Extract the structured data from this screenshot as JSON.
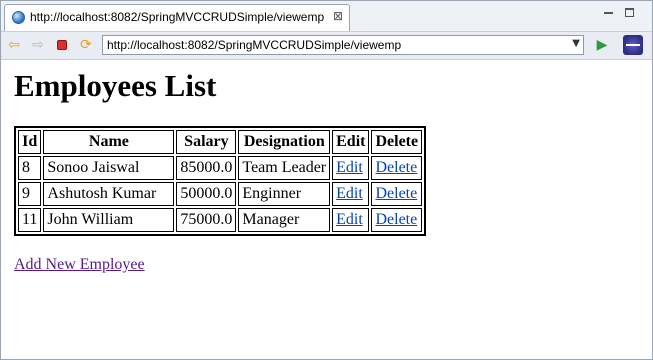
{
  "tab": {
    "title": "http://localhost:8082/SpringMVCCRUDSimple/viewemp",
    "close_glyph": "⊠"
  },
  "toolbar": {
    "url": "http://localhost:8082/SpringMVCCRUDSimple/viewemp",
    "icons": [
      "back-arrow-icon",
      "forward-arrow-icon",
      "stop-icon",
      "refresh-icon",
      "go-icon",
      "eclipse-icon"
    ]
  },
  "page": {
    "heading": "Employees List",
    "columns": [
      "Id",
      "Name",
      "Salary",
      "Designation",
      "Edit",
      "Delete"
    ],
    "rows": [
      {
        "id": "8",
        "name": "Sonoo Jaiswal",
        "salary": "85000.0",
        "designation": "Team Leader",
        "edit": "Edit",
        "delete": "Delete"
      },
      {
        "id": "9",
        "name": "Ashutosh Kumar",
        "salary": "50000.0",
        "designation": "Enginner",
        "edit": "Edit",
        "delete": "Delete"
      },
      {
        "id": "11",
        "name": "John William",
        "salary": "75000.0",
        "designation": "Manager",
        "edit": "Edit",
        "delete": "Delete"
      }
    ],
    "add_link": "Add New Employee"
  },
  "colors": {
    "link": "#0645ad",
    "visited_link": "#551a8b",
    "stop": "#d9302c",
    "go": "#2e9b3a"
  }
}
